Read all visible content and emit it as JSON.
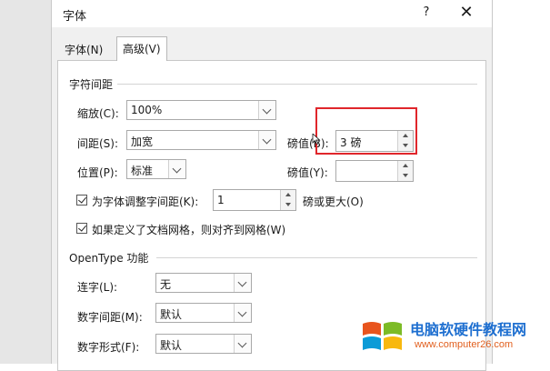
{
  "dialog": {
    "title": "字体",
    "help": "?",
    "close": "✕"
  },
  "tabs": [
    {
      "label": "字体(N)"
    },
    {
      "label": "高级(V)"
    }
  ],
  "char_spacing": {
    "section": "字符间距",
    "scale_label": "缩放(C):",
    "scale_value": "100%",
    "spacing_label": "间距(S):",
    "spacing_value": "加宽",
    "spacing_points_label": "磅值(B):",
    "spacing_points_value": "3 磅",
    "position_label": "位置(P):",
    "position_value": "标准",
    "position_points_label": "磅值(Y):",
    "position_points_value": "",
    "kerning_label": "为字体调整字间距(K):",
    "kerning_checked": true,
    "kerning_value": "1",
    "kerning_suffix": "磅或更大(O)",
    "grid_label": "如果定义了文档网格，则对齐到网格(W)",
    "grid_checked": true
  },
  "opentype": {
    "section": "OpenType 功能",
    "ligatures_label": "连字(L):",
    "ligatures_value": "无",
    "num_spacing_label": "数字间距(M):",
    "num_spacing_value": "默认",
    "num_form_label": "数字形式(F):",
    "num_form_value": "默认"
  },
  "watermark": {
    "title": "电脑软硬件教程网",
    "url": "www.computer26.com",
    "colors": {
      "title": "#1e6fd0",
      "url": "#e15f1e",
      "q1": "#e8541d",
      "q2": "#7cbb26",
      "q3": "#0b9bd7",
      "q4": "#f8b80e"
    }
  },
  "highlight_color": "#e0262b"
}
